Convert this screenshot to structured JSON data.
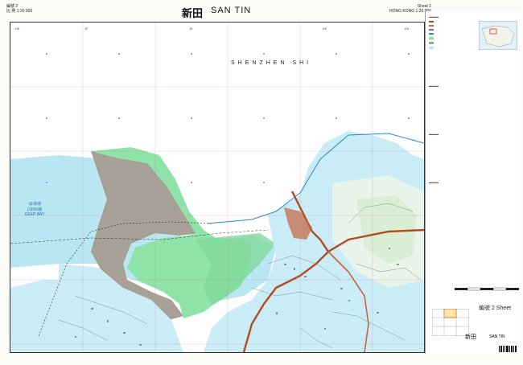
{
  "header": {
    "sheet_no_zh": "編號 2",
    "scale_zh": "比 例 1:20 000",
    "title_zh": "新田",
    "title_en": "SAN TIN",
    "sheet_en": "Sheet 2",
    "scale_en": "HONG KONG 1:20 000"
  },
  "map": {
    "region_label": "SHENZHEN SHI",
    "grid_labels": [
      "HE",
      "JF",
      "JK",
      "KE",
      "KK"
    ],
    "water_label_zh": "后海灣",
    "water_label_zh2": "(深圳灣)",
    "water_label_en": "DEEP BAY"
  },
  "footer": {
    "sheet_label": "編號 2 Sheet",
    "title_zh": "新田",
    "title_en": "SAN TIN"
  },
  "colors": {
    "sea": "#b9e6f3",
    "land_built": "#c9ecf7",
    "wetland": "#8fe3a8",
    "mudflat": "#a6a096",
    "road": "#c8643a",
    "highway": "#b34b1f"
  }
}
